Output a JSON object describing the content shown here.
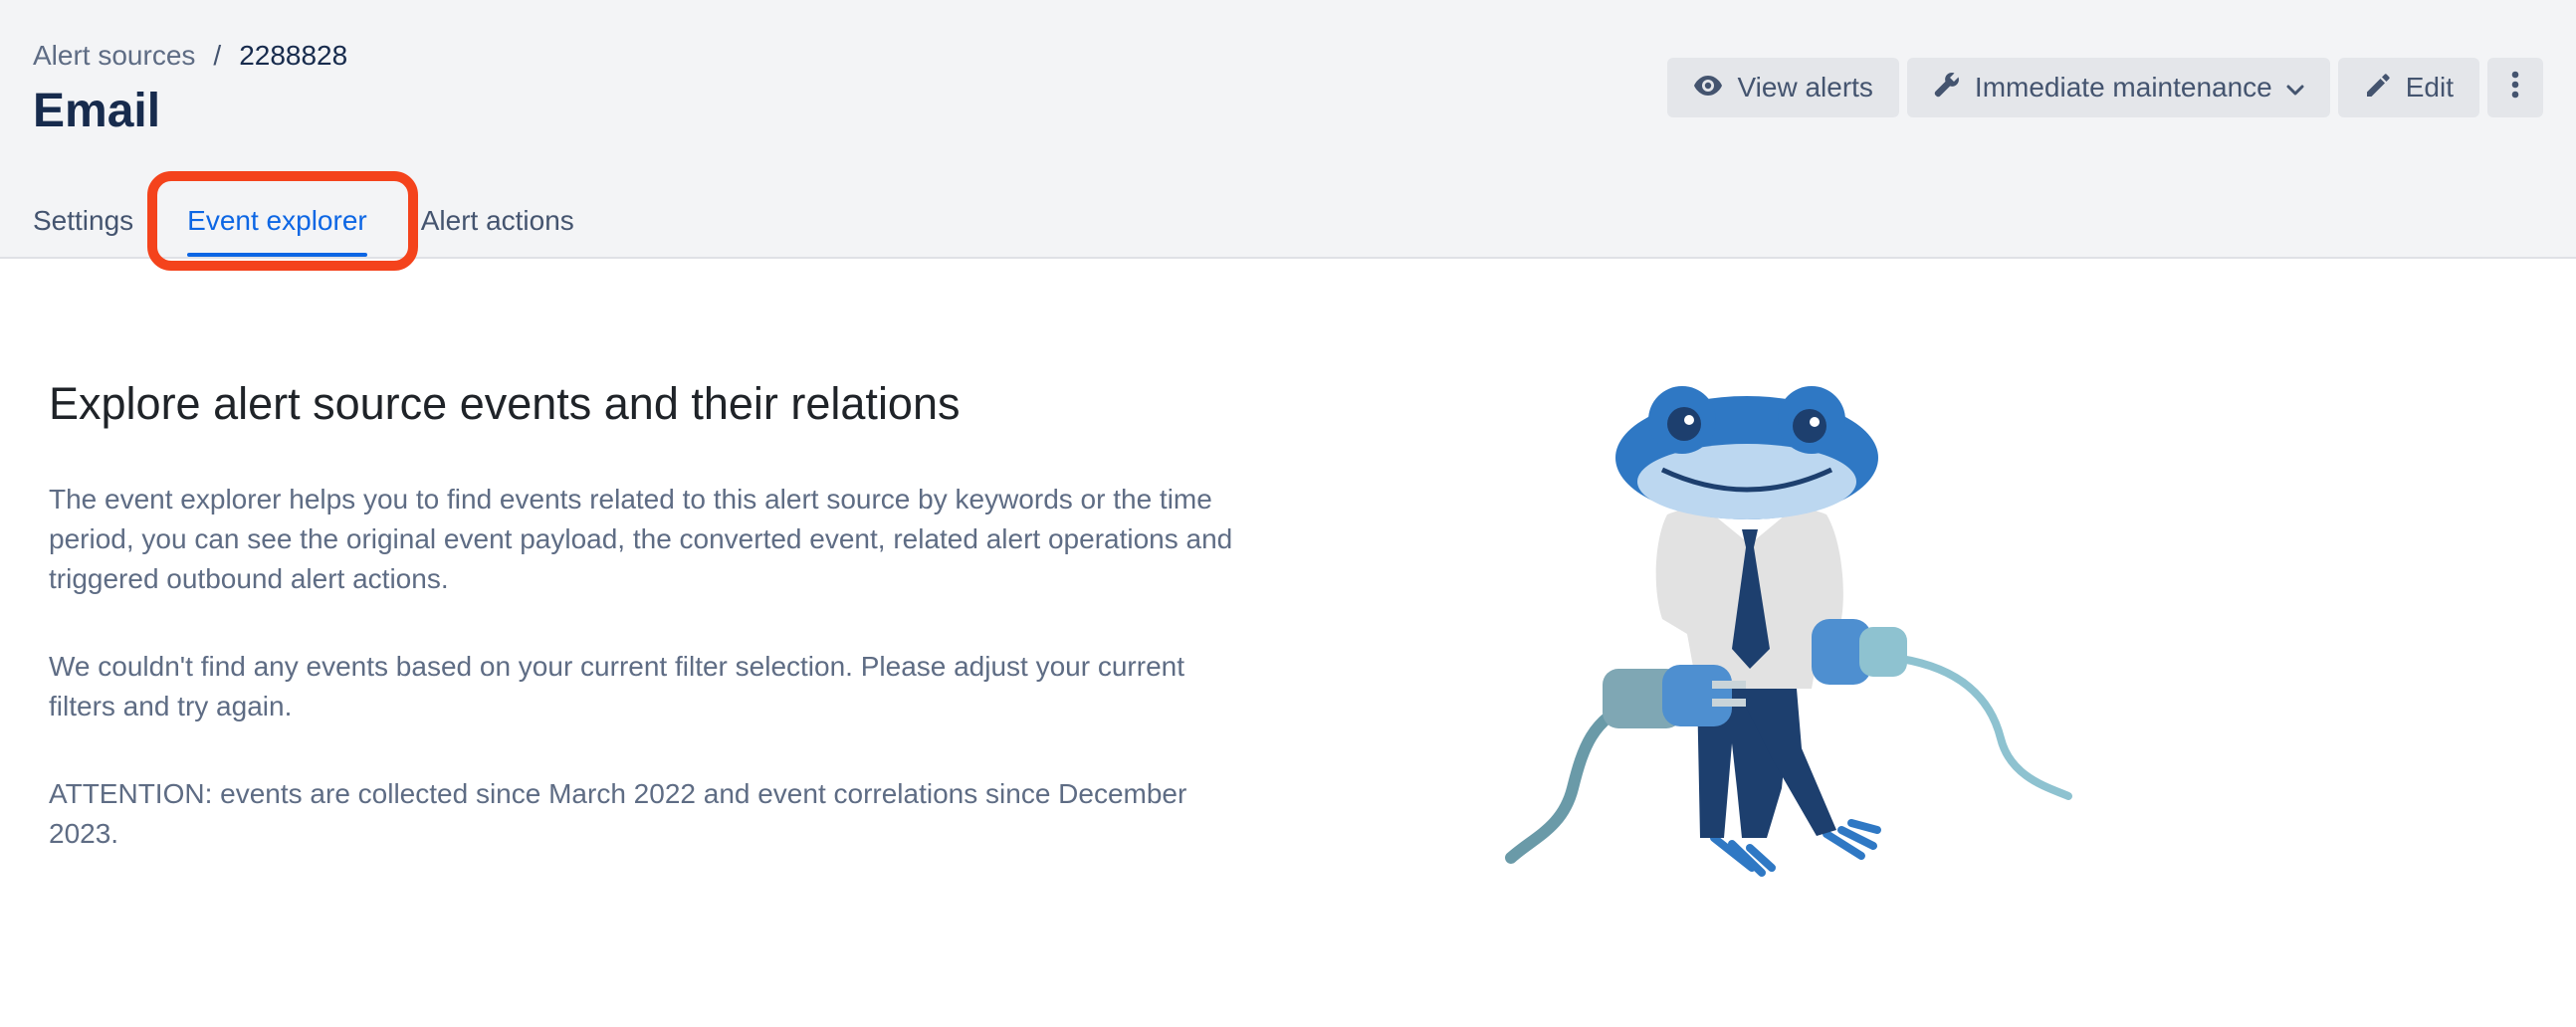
{
  "breadcrumb": {
    "parent": "Alert sources",
    "separator": "/",
    "current": "2288828"
  },
  "page": {
    "title": "Email"
  },
  "actions": {
    "view_alerts": "View alerts",
    "immediate_maintenance": "Immediate maintenance",
    "edit": "Edit"
  },
  "tabs": [
    {
      "label": "Settings",
      "active": false
    },
    {
      "label": "Event explorer",
      "active": true
    },
    {
      "label": "Alert actions",
      "active": false
    }
  ],
  "main": {
    "heading": "Explore alert source events and their relations",
    "paragraphs": [
      "The event explorer helps you to find events related to this alert source by keywords or the time period, you can see the original event payload, the converted event, related alert operations and triggered outbound alert actions.",
      "We couldn't find any events based on your current filter selection. Please adjust your current filters and try again.",
      "ATTENTION: events are collected since March 2022 and event correlations since December 2023."
    ]
  },
  "icons": {
    "view_alerts": "eye-icon",
    "maintenance": "wrench-icon",
    "dropdown": "chevron-down-icon",
    "edit": "pencil-icon",
    "more": "more-vertical-icon"
  },
  "colors": {
    "accent": "#0c66e4",
    "highlight": "#f4431c",
    "header_bg": "#f3f4f6"
  }
}
